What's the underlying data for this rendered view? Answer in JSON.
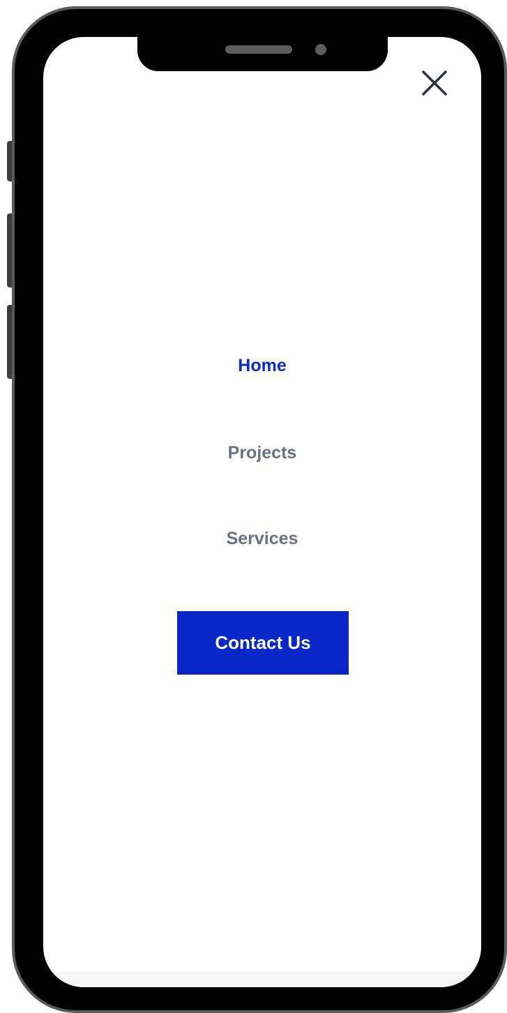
{
  "menu": {
    "items": [
      {
        "label": "Home",
        "active": true
      },
      {
        "label": "Projects",
        "active": false
      },
      {
        "label": "Services",
        "active": false
      }
    ],
    "cta_label": "Contact Us"
  },
  "icons": {
    "close": "close-icon"
  },
  "colors": {
    "accent": "#0827C7",
    "inactive_text": "#6B7185",
    "icon": "#2D3142",
    "frame": "#000000",
    "frame_border": "#5A5A5A"
  }
}
